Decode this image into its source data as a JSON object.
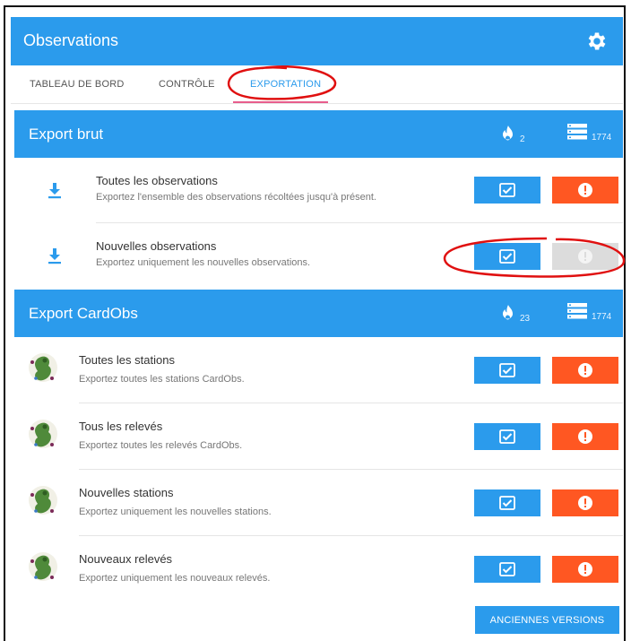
{
  "app": {
    "title": "Observations",
    "settings_icon": "gear-icon"
  },
  "tabs": [
    {
      "label": "TABLEAU DE BORD"
    },
    {
      "label": "CONTRÔLE"
    },
    {
      "label": "EXPORTATION",
      "active": true
    }
  ],
  "raw_export": {
    "title": "Export brut",
    "new_count": "2",
    "total_count": "1774",
    "rows": [
      {
        "label": "Toutes les observations",
        "description": "Exportez l'ensemble des observations récoltées jusqu'à présent.",
        "error_enabled": true
      },
      {
        "label": "Nouvelles observations",
        "description": "Exportez uniquement les nouvelles observations.",
        "error_enabled": false
      }
    ]
  },
  "cardobs_export": {
    "title": "Export CardObs",
    "new_count": "23",
    "total_count": "1774",
    "rows": [
      {
        "label": "Toutes les stations",
        "description": "Exportez toutes les stations CardObs."
      },
      {
        "label": "Tous les relevés",
        "description": "Exportez toutes les relevés CardObs."
      },
      {
        "label": "Nouvelles stations",
        "description": "Exportez uniquement les nouvelles stations."
      },
      {
        "label": "Nouveaux relevés",
        "description": "Exportez uniquement les nouveaux relevés."
      }
    ]
  },
  "old_versions_label": "ANCIENNES VERSIONS",
  "colors": {
    "primary": "#2b9bec",
    "danger": "#ff5722",
    "disabled": "#dcdcdc",
    "annotation": "#e01010",
    "tab_indicator": "#e85d8c"
  }
}
